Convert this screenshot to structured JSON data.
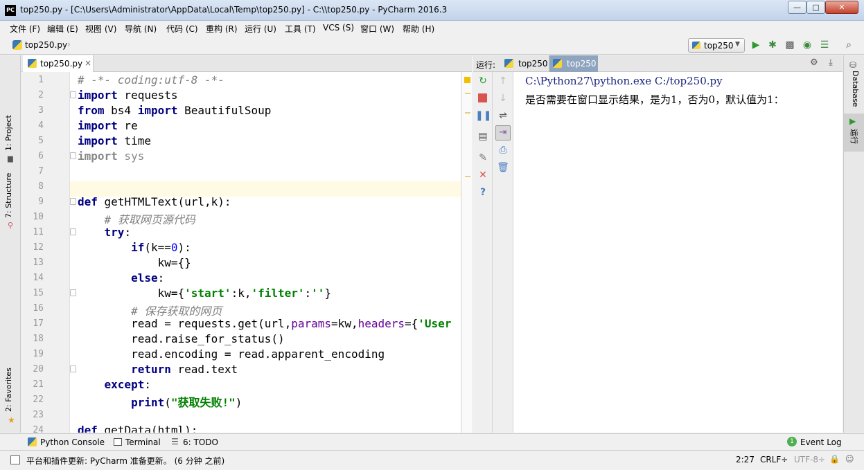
{
  "window": {
    "title": "top250.py - [C:\\Users\\Administrator\\AppData\\Local\\Temp\\top250.py] - C:\\\\top250.py - PyCharm 2016.3",
    "app_icon": "PC",
    "minimize": "—",
    "maximize": "□",
    "close": "✕"
  },
  "menu": [
    "文件 (F)",
    "编辑 (E)",
    "视图 (V)",
    "导航 (N)",
    "代码 (C)",
    "重构 (R)",
    "运行 (U)",
    "工具 (T)",
    "VCS (S)",
    "窗口 (W)",
    "帮助 (H)"
  ],
  "nav": {
    "breadcrumb": "top250.py",
    "run_config": "top250"
  },
  "left_tools": {
    "project": "1: Project",
    "structure": "7: Structure",
    "favorites": "2: Favorites"
  },
  "right_tools": {
    "database": "Database",
    "run": "运行"
  },
  "editor": {
    "tab_label": "top250.py",
    "tab_close": "×",
    "line_numbers": [
      "1",
      "2",
      "3",
      "4",
      "5",
      "6",
      "7",
      "8",
      "9",
      "10",
      "11",
      "12",
      "13",
      "14",
      "15",
      "16",
      "17",
      "18",
      "19",
      "20",
      "21",
      "22",
      "23",
      "24"
    ]
  },
  "run_panel": {
    "label": "运行:",
    "tabs": [
      "top250",
      "top250"
    ],
    "console_lines": [
      "C:\\Python27\\python.exe C:/top250.py",
      "是否需要在窗口显示结果，是为1，否为0，默认值为1："
    ]
  },
  "bottom_tabs": {
    "python_console": "Python Console",
    "terminal": "Terminal",
    "todo": "6: TODO",
    "event_log": "Event Log",
    "event_count": "1"
  },
  "status": {
    "message": "平台和插件更新: PyCharm 准备更新。 (6 分钟 之前)",
    "position": "2:27",
    "line_sep": "CRLF÷",
    "encoding": "UTF-8÷"
  },
  "colors": {
    "keyword": "#000080",
    "string": "#008000",
    "comment": "#808080",
    "number": "#0000ff",
    "param": "#660099",
    "console_cmd": "#1a237e",
    "caret_line": "#fffae3"
  }
}
